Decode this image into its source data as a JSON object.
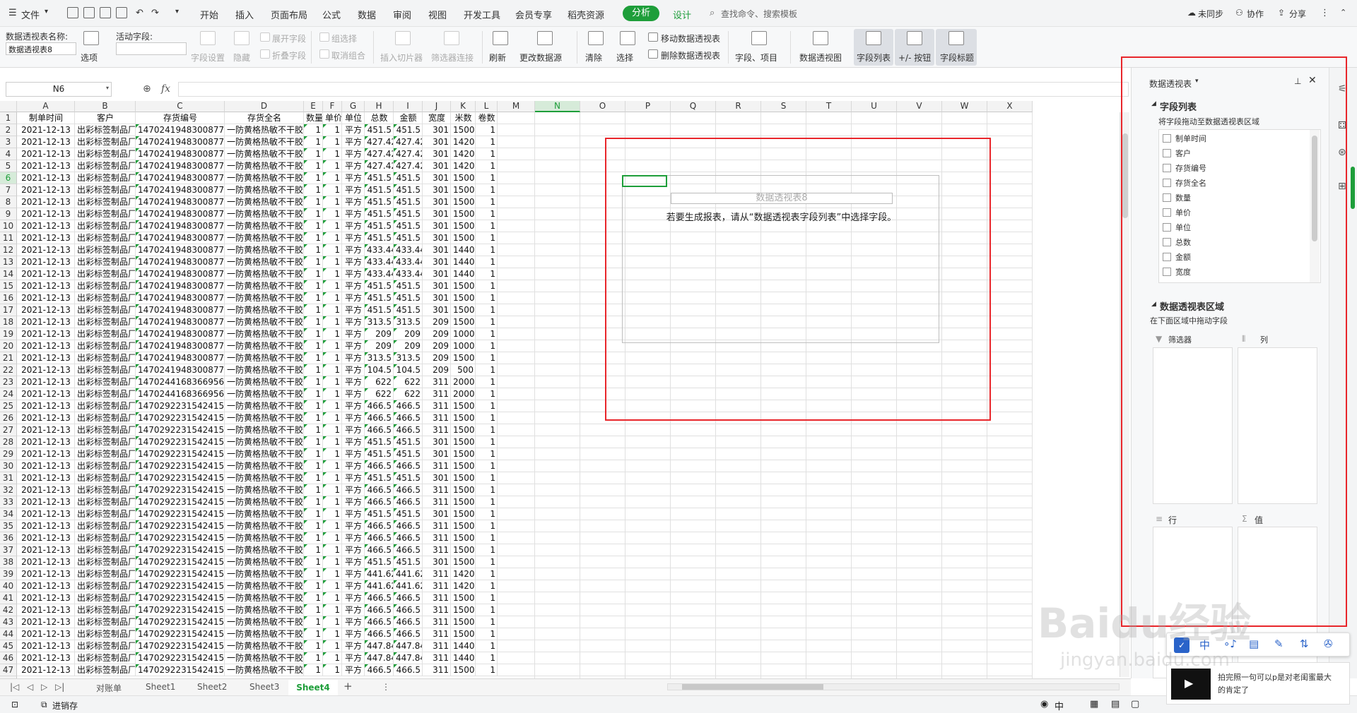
{
  "menu": {
    "file": "文件",
    "items": [
      "开始",
      "插入",
      "页面布局",
      "公式",
      "数据",
      "审阅",
      "视图",
      "开发工具",
      "会员专享",
      "稻壳资源"
    ],
    "active": "分析",
    "design": "设计",
    "search": "查找命令、搜索模板",
    "unsync": "未同步",
    "collab": "协作",
    "share": "分享"
  },
  "ribbon": {
    "pt_name_label": "数据透视表名称:",
    "pt_name": "数据透视表8",
    "options": "选项",
    "active_field_label": "活动字段:",
    "field_settings": "字段设置",
    "hide": "隐藏",
    "expand_field": "展开字段",
    "collapse_field": "折叠字段",
    "group_selection": "组选择",
    "ungroup": "取消组合",
    "insert_slicer": "插入切片器",
    "filter_conn": "筛选器连接",
    "refresh": "刷新",
    "change_source": "更改数据源",
    "clear": "清除",
    "select": "选择",
    "move_pt": "移动数据透视表",
    "delete_pt": "删除数据透视表",
    "fields_items": "字段、项目",
    "pivot_chart": "数据透视图",
    "field_list": "字段列表",
    "plus_minus": "+/- 按钮",
    "field_headers": "字段标题"
  },
  "formula": {
    "namebox": "N6",
    "fx": "fx"
  },
  "columns": [
    "A",
    "B",
    "C",
    "D",
    "E",
    "F",
    "G",
    "H",
    "I",
    "J",
    "K",
    "L",
    "M",
    "N",
    "O",
    "P",
    "Q",
    "R",
    "S",
    "T",
    "U",
    "V",
    "W",
    "X"
  ],
  "header_row": [
    "制单时间",
    "客户",
    "存货编号",
    "存货全名",
    "数量",
    "单价",
    "单位",
    "总数",
    "金额",
    "宽度",
    "米数",
    "卷数"
  ],
  "rows": [
    [
      "2021-12-13",
      "出彩标签制品厂",
      "1470241948300877826",
      "一防黄格热敏不干胶",
      "1",
      "1",
      "平方",
      "451.5",
      "451.5",
      "301",
      "1500",
      "1"
    ],
    [
      "2021-12-13",
      "出彩标签制品厂",
      "1470241948300877826",
      "一防黄格热敏不干胶",
      "1",
      "1",
      "平方",
      "427.42",
      "427.42",
      "301",
      "1420",
      "1"
    ],
    [
      "2021-12-13",
      "出彩标签制品厂",
      "1470241948300877826",
      "一防黄格热敏不干胶",
      "1",
      "1",
      "平方",
      "427.42",
      "427.42",
      "301",
      "1420",
      "1"
    ],
    [
      "2021-12-13",
      "出彩标签制品厂",
      "1470241948300877826",
      "一防黄格热敏不干胶",
      "1",
      "1",
      "平方",
      "427.42",
      "427.42",
      "301",
      "1420",
      "1"
    ],
    [
      "2021-12-13",
      "出彩标签制品厂",
      "1470241948300877826",
      "一防黄格热敏不干胶",
      "1",
      "1",
      "平方",
      "451.5",
      "451.5",
      "301",
      "1500",
      "1"
    ],
    [
      "2021-12-13",
      "出彩标签制品厂",
      "1470241948300877826",
      "一防黄格热敏不干胶",
      "1",
      "1",
      "平方",
      "451.5",
      "451.5",
      "301",
      "1500",
      "1"
    ],
    [
      "2021-12-13",
      "出彩标签制品厂",
      "1470241948300877826",
      "一防黄格热敏不干胶",
      "1",
      "1",
      "平方",
      "451.5",
      "451.5",
      "301",
      "1500",
      "1"
    ],
    [
      "2021-12-13",
      "出彩标签制品厂",
      "1470241948300877826",
      "一防黄格热敏不干胶",
      "1",
      "1",
      "平方",
      "451.5",
      "451.5",
      "301",
      "1500",
      "1"
    ],
    [
      "2021-12-13",
      "出彩标签制品厂",
      "1470241948300877826",
      "一防黄格热敏不干胶",
      "1",
      "1",
      "平方",
      "451.5",
      "451.5",
      "301",
      "1500",
      "1"
    ],
    [
      "2021-12-13",
      "出彩标签制品厂",
      "1470241948300877826",
      "一防黄格热敏不干胶",
      "1",
      "1",
      "平方",
      "451.5",
      "451.5",
      "301",
      "1500",
      "1"
    ],
    [
      "2021-12-13",
      "出彩标签制品厂",
      "1470241948300877826",
      "一防黄格热敏不干胶",
      "1",
      "1",
      "平方",
      "433.44",
      "433.44",
      "301",
      "1440",
      "1"
    ],
    [
      "2021-12-13",
      "出彩标签制品厂",
      "1470241948300877826",
      "一防黄格热敏不干胶",
      "1",
      "1",
      "平方",
      "433.44",
      "433.44",
      "301",
      "1440",
      "1"
    ],
    [
      "2021-12-13",
      "出彩标签制品厂",
      "1470241948300877826",
      "一防黄格热敏不干胶",
      "1",
      "1",
      "平方",
      "433.44",
      "433.44",
      "301",
      "1440",
      "1"
    ],
    [
      "2021-12-13",
      "出彩标签制品厂",
      "1470241948300877826",
      "一防黄格热敏不干胶",
      "1",
      "1",
      "平方",
      "451.5",
      "451.5",
      "301",
      "1500",
      "1"
    ],
    [
      "2021-12-13",
      "出彩标签制品厂",
      "1470241948300877826",
      "一防黄格热敏不干胶",
      "1",
      "1",
      "平方",
      "451.5",
      "451.5",
      "301",
      "1500",
      "1"
    ],
    [
      "2021-12-13",
      "出彩标签制品厂",
      "1470241948300877826",
      "一防黄格热敏不干胶",
      "1",
      "1",
      "平方",
      "451.5",
      "451.5",
      "301",
      "1500",
      "1"
    ],
    [
      "2021-12-13",
      "出彩标签制品厂",
      "1470241948300877826",
      "一防黄格热敏不干胶",
      "1",
      "1",
      "平方",
      "313.5",
      "313.5",
      "209",
      "1500",
      "1"
    ],
    [
      "2021-12-13",
      "出彩标签制品厂",
      "1470241948300877826",
      "一防黄格热敏不干胶",
      "1",
      "1",
      "平方",
      "209",
      "209",
      "209",
      "1000",
      "1"
    ],
    [
      "2021-12-13",
      "出彩标签制品厂",
      "1470241948300877826",
      "一防黄格热敏不干胶",
      "1",
      "1",
      "平方",
      "209",
      "209",
      "209",
      "1000",
      "1"
    ],
    [
      "2021-12-13",
      "出彩标签制品厂",
      "1470241948300877826",
      "一防黄格热敏不干胶",
      "1",
      "1",
      "平方",
      "313.5",
      "313.5",
      "209",
      "1500",
      "1"
    ],
    [
      "2021-12-13",
      "出彩标签制品厂",
      "1470241948300877826",
      "一防黄格热敏不干胶",
      "1",
      "1",
      "平方",
      "104.5",
      "104.5",
      "209",
      "500",
      "1"
    ],
    [
      "2021-12-13",
      "出彩标签制品厂",
      "1470244168366956545",
      "一防黄格热敏不干胶",
      "1",
      "1",
      "平方",
      "622",
      "622",
      "311",
      "2000",
      "1"
    ],
    [
      "2021-12-13",
      "出彩标签制品厂",
      "1470244168366956545",
      "一防黄格热敏不干胶",
      "1",
      "1",
      "平方",
      "622",
      "622",
      "311",
      "2000",
      "1"
    ],
    [
      "2021-12-13",
      "出彩标签制品厂",
      "1470292231542415361",
      "一防黄格热敏不干胶",
      "1",
      "1",
      "平方",
      "466.5",
      "466.5",
      "311",
      "1500",
      "1"
    ],
    [
      "2021-12-13",
      "出彩标签制品厂",
      "1470292231542415361",
      "一防黄格热敏不干胶",
      "1",
      "1",
      "平方",
      "466.5",
      "466.5",
      "311",
      "1500",
      "1"
    ],
    [
      "2021-12-13",
      "出彩标签制品厂",
      "1470292231542415361",
      "一防黄格热敏不干胶",
      "1",
      "1",
      "平方",
      "466.5",
      "466.5",
      "311",
      "1500",
      "1"
    ],
    [
      "2021-12-13",
      "出彩标签制品厂",
      "1470292231542415361",
      "一防黄格热敏不干胶",
      "1",
      "1",
      "平方",
      "451.5",
      "451.5",
      "301",
      "1500",
      "1"
    ],
    [
      "2021-12-13",
      "出彩标签制品厂",
      "1470292231542415361",
      "一防黄格热敏不干胶",
      "1",
      "1",
      "平方",
      "451.5",
      "451.5",
      "301",
      "1500",
      "1"
    ],
    [
      "2021-12-13",
      "出彩标签制品厂",
      "1470292231542415361",
      "一防黄格热敏不干胶",
      "1",
      "1",
      "平方",
      "466.5",
      "466.5",
      "311",
      "1500",
      "1"
    ],
    [
      "2021-12-13",
      "出彩标签制品厂",
      "1470292231542415361",
      "一防黄格热敏不干胶",
      "1",
      "1",
      "平方",
      "451.5",
      "451.5",
      "301",
      "1500",
      "1"
    ],
    [
      "2021-12-13",
      "出彩标签制品厂",
      "1470292231542415361",
      "一防黄格热敏不干胶",
      "1",
      "1",
      "平方",
      "466.5",
      "466.5",
      "311",
      "1500",
      "1"
    ],
    [
      "2021-12-13",
      "出彩标签制品厂",
      "1470292231542415361",
      "一防黄格热敏不干胶",
      "1",
      "1",
      "平方",
      "466.5",
      "466.5",
      "311",
      "1500",
      "1"
    ],
    [
      "2021-12-13",
      "出彩标签制品厂",
      "1470292231542415361",
      "一防黄格热敏不干胶",
      "1",
      "1",
      "平方",
      "451.5",
      "451.5",
      "301",
      "1500",
      "1"
    ],
    [
      "2021-12-13",
      "出彩标签制品厂",
      "1470292231542415361",
      "一防黄格热敏不干胶",
      "1",
      "1",
      "平方",
      "466.5",
      "466.5",
      "311",
      "1500",
      "1"
    ],
    [
      "2021-12-13",
      "出彩标签制品厂",
      "1470292231542415361",
      "一防黄格热敏不干胶",
      "1",
      "1",
      "平方",
      "466.5",
      "466.5",
      "311",
      "1500",
      "1"
    ],
    [
      "2021-12-13",
      "出彩标签制品厂",
      "1470292231542415361",
      "一防黄格热敏不干胶",
      "1",
      "1",
      "平方",
      "466.5",
      "466.5",
      "311",
      "1500",
      "1"
    ],
    [
      "2021-12-13",
      "出彩标签制品厂",
      "1470292231542415361",
      "一防黄格热敏不干胶",
      "1",
      "1",
      "平方",
      "451.5",
      "451.5",
      "301",
      "1500",
      "1"
    ],
    [
      "2021-12-13",
      "出彩标签制品厂",
      "1470292231542415361",
      "一防黄格热敏不干胶",
      "1",
      "1",
      "平方",
      "441.62",
      "441.62",
      "311",
      "1420",
      "1"
    ],
    [
      "2021-12-13",
      "出彩标签制品厂",
      "1470292231542415361",
      "一防黄格热敏不干胶",
      "1",
      "1",
      "平方",
      "441.62",
      "441.62",
      "311",
      "1420",
      "1"
    ],
    [
      "2021-12-13",
      "出彩标签制品厂",
      "1470292231542415361",
      "一防黄格热敏不干胶",
      "1",
      "1",
      "平方",
      "466.5",
      "466.5",
      "311",
      "1500",
      "1"
    ],
    [
      "2021-12-13",
      "出彩标签制品厂",
      "1470292231542415361",
      "一防黄格热敏不干胶",
      "1",
      "1",
      "平方",
      "466.5",
      "466.5",
      "311",
      "1500",
      "1"
    ],
    [
      "2021-12-13",
      "出彩标签制品厂",
      "1470292231542415361",
      "一防黄格热敏不干胶",
      "1",
      "1",
      "平方",
      "466.5",
      "466.5",
      "311",
      "1500",
      "1"
    ],
    [
      "2021-12-13",
      "出彩标签制品厂",
      "1470292231542415361",
      "一防黄格热敏不干胶",
      "1",
      "1",
      "平方",
      "466.5",
      "466.5",
      "311",
      "1500",
      "1"
    ],
    [
      "2021-12-13",
      "出彩标签制品厂",
      "1470292231542415361",
      "一防黄格热敏不干胶",
      "1",
      "1",
      "平方",
      "447.84",
      "447.84",
      "311",
      "1440",
      "1"
    ],
    [
      "2021-12-13",
      "出彩标签制品厂",
      "1470292231542415361",
      "一防黄格热敏不干胶",
      "1",
      "1",
      "平方",
      "447.84",
      "447.84",
      "311",
      "1440",
      "1"
    ],
    [
      "2021-12-13",
      "出彩标签制品厂",
      "1470292231542415361",
      "一防黄格热敏不干胶",
      "1",
      "1",
      "平方",
      "466.5",
      "466.5",
      "311",
      "1500",
      "1"
    ]
  ],
  "pivot": {
    "title": "数据透视表8",
    "hint": "若要生成报表，请从“数据透视表字段列表”中选择字段。"
  },
  "sheets": [
    "对账单",
    "Sheet1",
    "Sheet2",
    "Sheet3",
    "Sheet4"
  ],
  "active_sheet": "Sheet4",
  "status": {
    "mode": "进销存"
  },
  "panel": {
    "title": "数据透视表",
    "field_list": "字段列表",
    "drag_hint": "将字段拖动至数据透视表区域",
    "fields": [
      "制单时间",
      "客户",
      "存货编号",
      "存货全名",
      "数量",
      "单价",
      "单位",
      "总数",
      "金额",
      "宽度"
    ],
    "areas_title": "数据透视表区域",
    "areas_hint": "在下面区域中拖动字段",
    "filter": "筛选器",
    "cols": "列",
    "rows": "行",
    "values": "值"
  },
  "watermark": {
    "text": "Baidu经验",
    "sub": "jingyan.baidu.com"
  },
  "popup": {
    "line1": "拍完照一句可以p是对老闺蜜最大",
    "line2": "的肯定了"
  },
  "colors": {
    "accent": "#1e9e3a",
    "red": "#e8262b"
  }
}
